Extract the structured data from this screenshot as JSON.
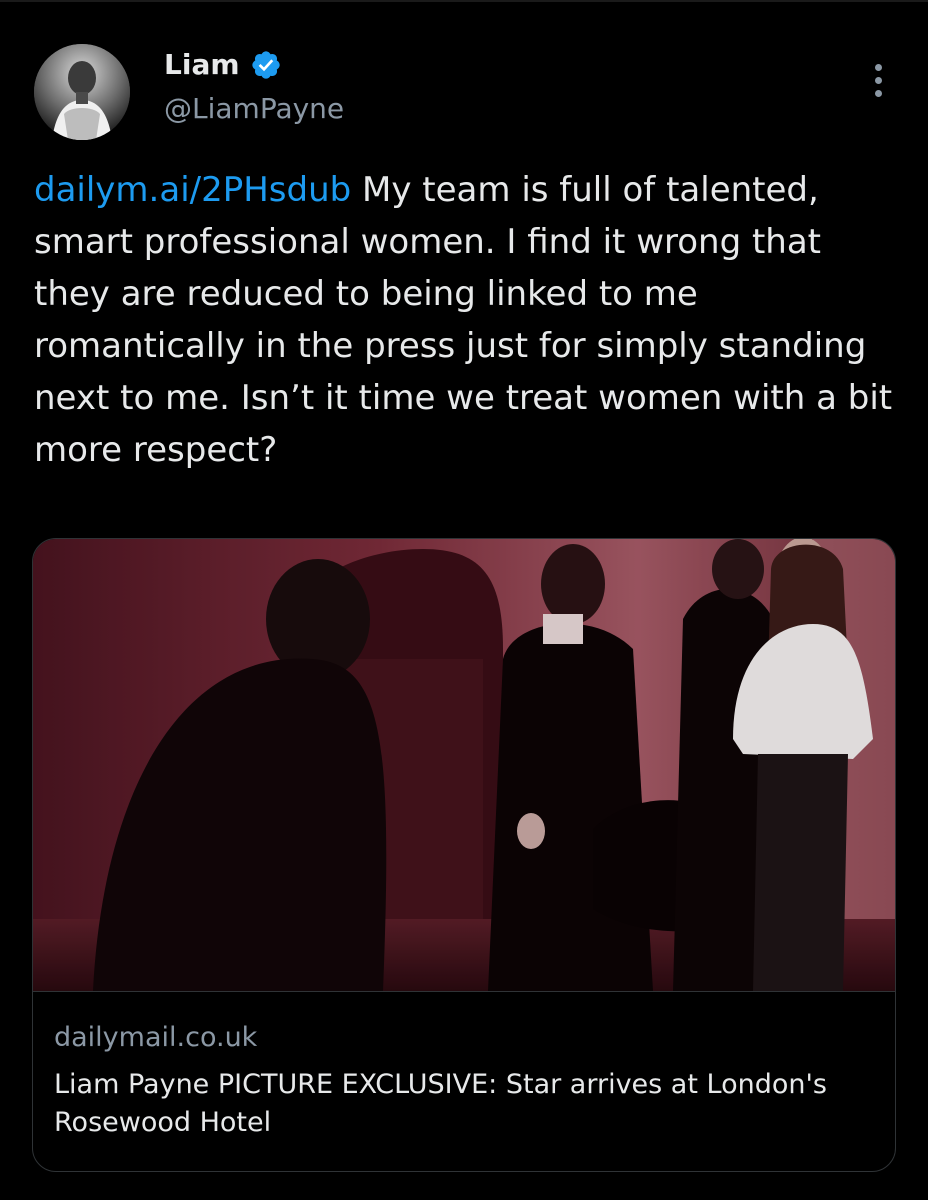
{
  "author": {
    "name": "Liam",
    "handle": "@LiamPayne",
    "verified": true,
    "verified_color": "#1d9bf0",
    "avatar": "profile-photo"
  },
  "more_icon": "more-vertical-icon",
  "tweet": {
    "link_text": "dailym.ai/2PHsdub",
    "text": " My team is full of talented, smart professional women. I find it wrong that they are reduced to being linked to me romantically in the press just for simply standing next to me. Isn’t it time we treat women with a bit more respect?"
  },
  "card": {
    "image": "paparazzi-photo-group-arriving-at-hotel-night",
    "domain": "dailymail.co.uk",
    "title": "Liam Payne PICTURE EXCLUSIVE: Star arrives at London's Rosewood Hotel"
  },
  "colors": {
    "background": "#000000",
    "text": "#e7e9ea",
    "secondary_text": "#8b98a5",
    "link": "#1d9bf0",
    "border": "#2f3336"
  }
}
